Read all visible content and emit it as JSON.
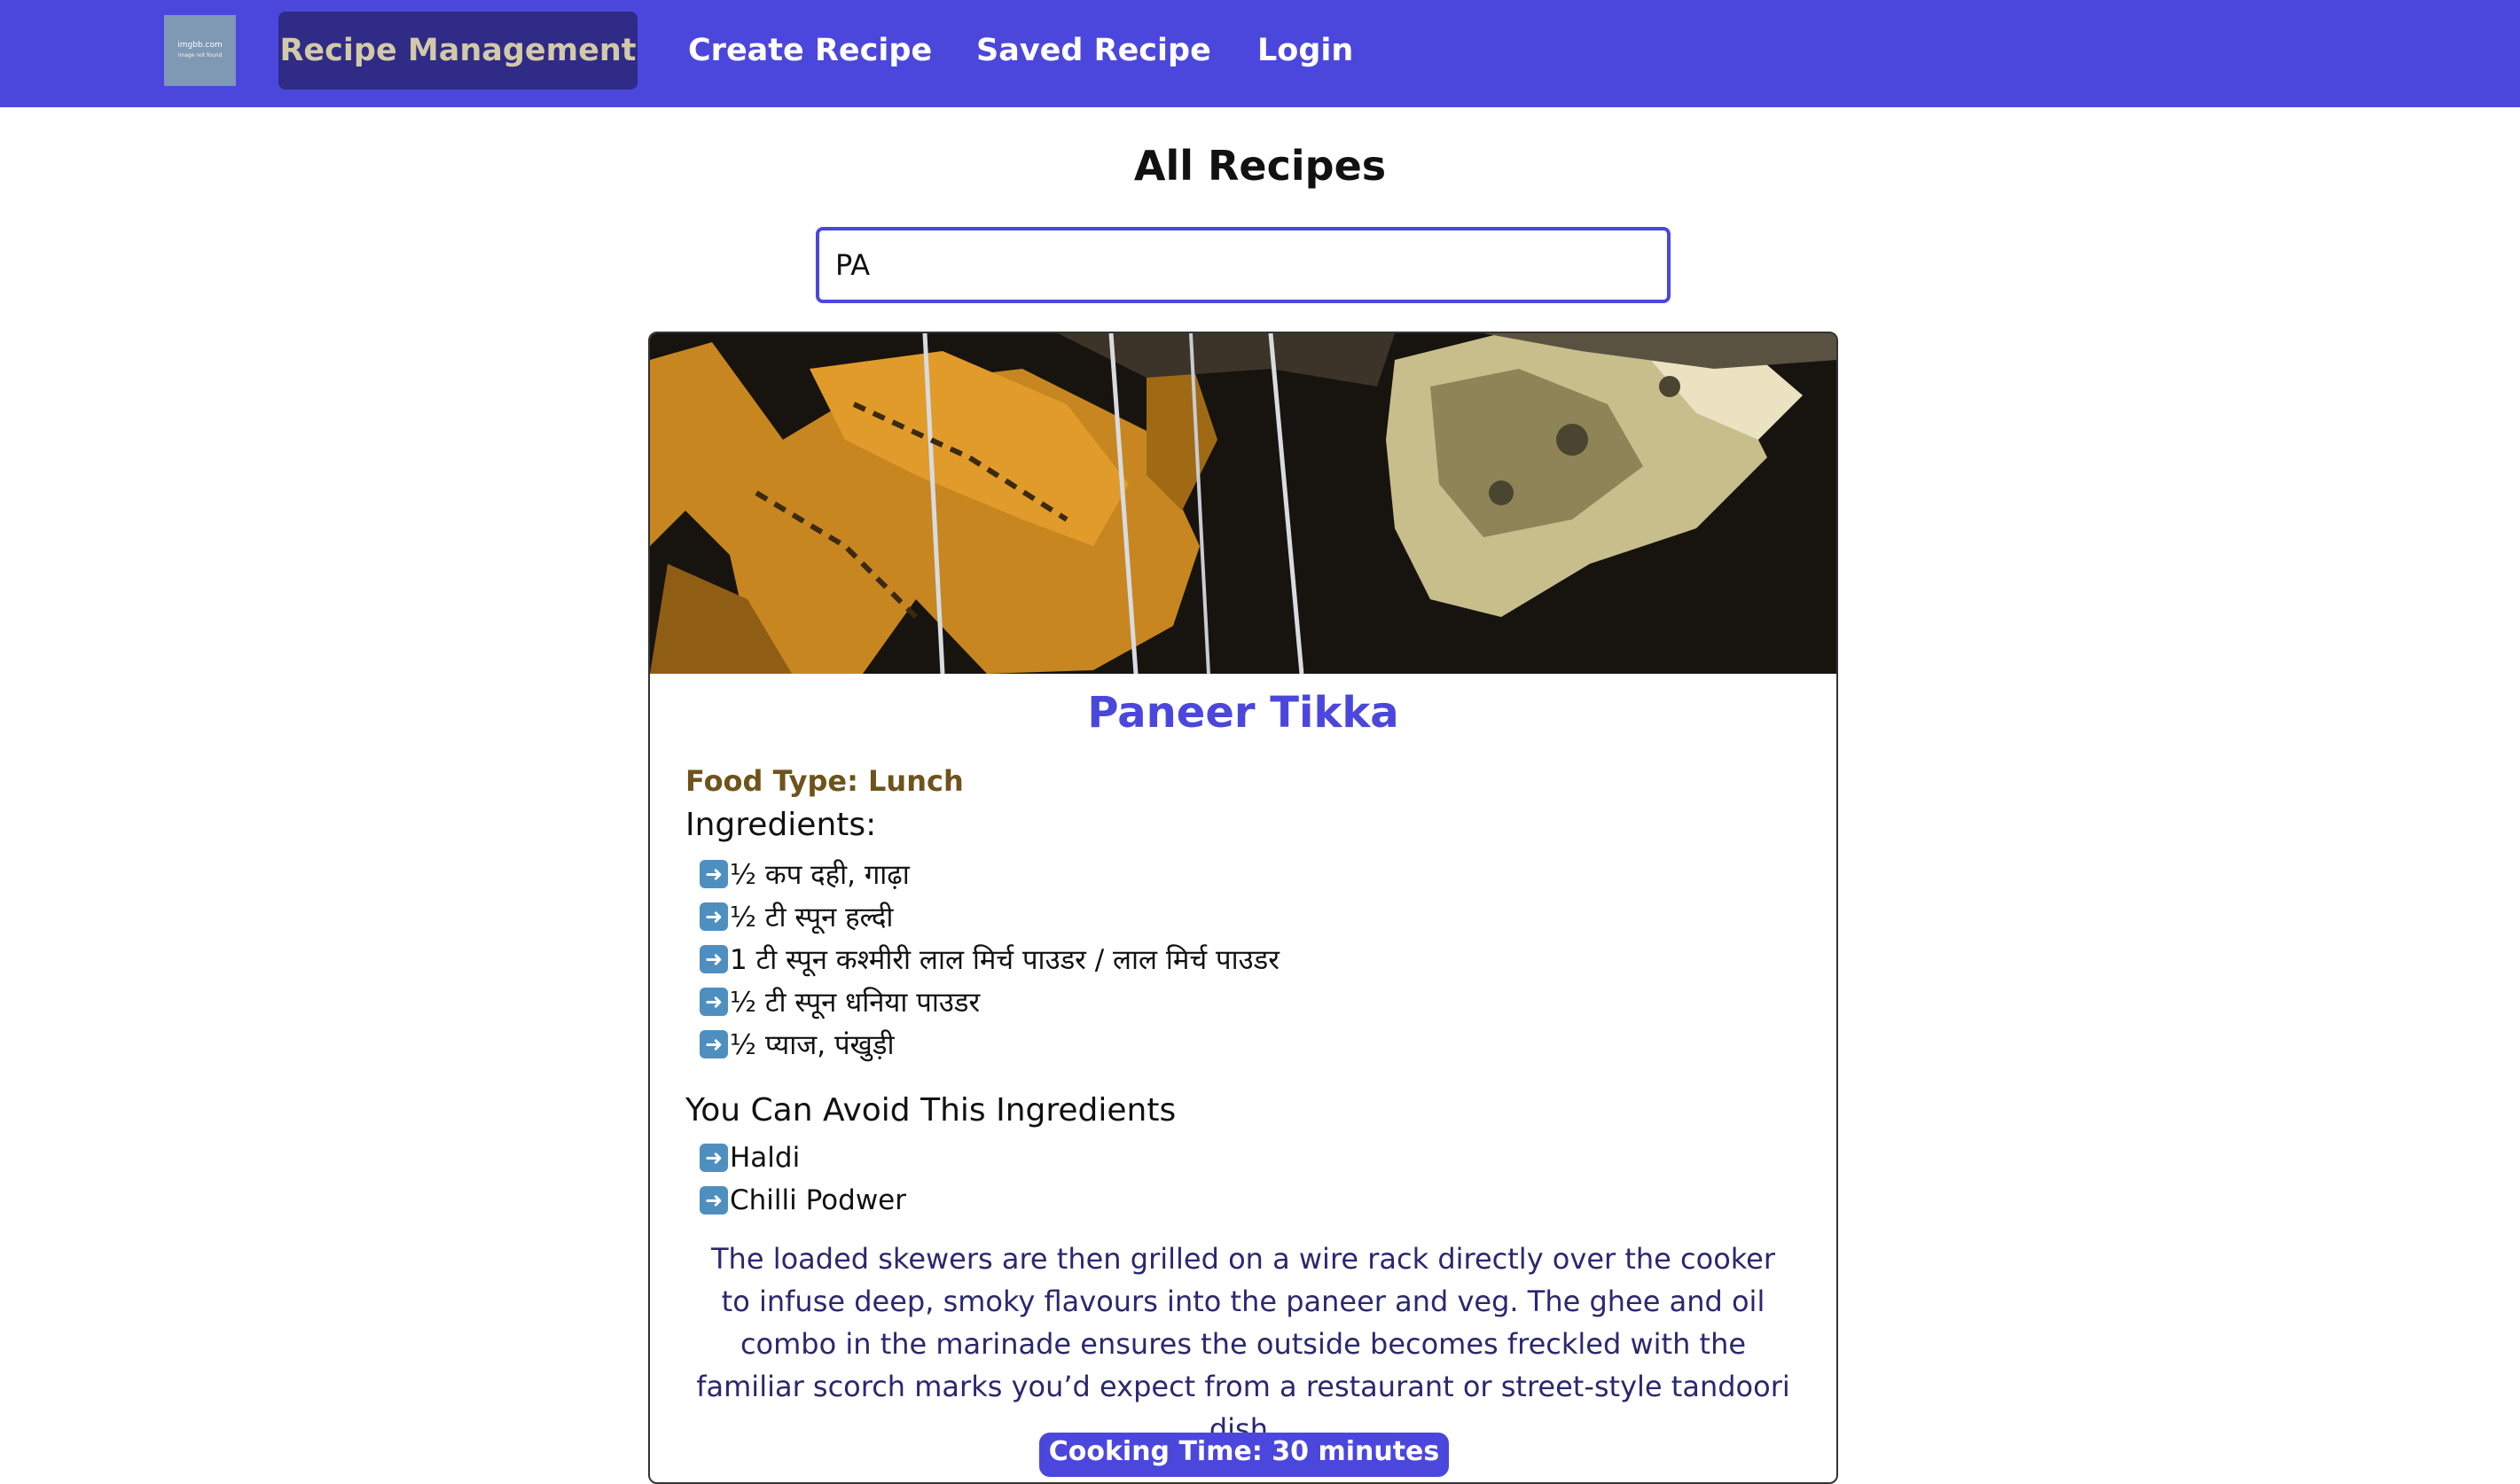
{
  "navbar": {
    "logo_line1": "imgbb.com",
    "logo_line2": "image not found",
    "brand": "Recipe Management",
    "links": [
      "Create Recipe",
      "Saved Recipe",
      "Login"
    ]
  },
  "page": {
    "title": "All Recipes"
  },
  "search": {
    "value": "PA"
  },
  "recipe": {
    "title": "Paneer Tikka",
    "food_type": "Food Type: Lunch",
    "ingredients_heading": "Ingredients:",
    "ingredients": [
      "½ कप दही, गाढ़ा",
      "½ टी स्पून हल्दी",
      "1 टी स्पून कश्मीरी लाल मिर्च पाउडर / लाल मिर्च पाउडर",
      "½ टी स्पून धनिया पाउडर",
      "½ प्याज, पंखुड़ी"
    ],
    "avoid_heading": "You Can Avoid This Ingredients",
    "avoid": [
      "Haldi",
      "Chilli Podwer"
    ],
    "description": "The loaded skewers are then grilled on a wire rack directly over the cooker to infuse deep, smoky flavours into the paneer and veg. The ghee and oil combo in the marinade ensures the outside becomes freckled with the familiar scorch marks you’d expect from a restaurant or street-style tandoori dish.",
    "cooking_time": "Cooking Time: 30 minutes"
  },
  "colors": {
    "nav_bg": "#4b47dc",
    "brand_bg": "#2f2b86",
    "accent": "#4b47dc",
    "food_type": "#6e531b",
    "description": "#2a2870"
  },
  "icons": [
    "image-logo-icon",
    "arrow-right-icon"
  ]
}
